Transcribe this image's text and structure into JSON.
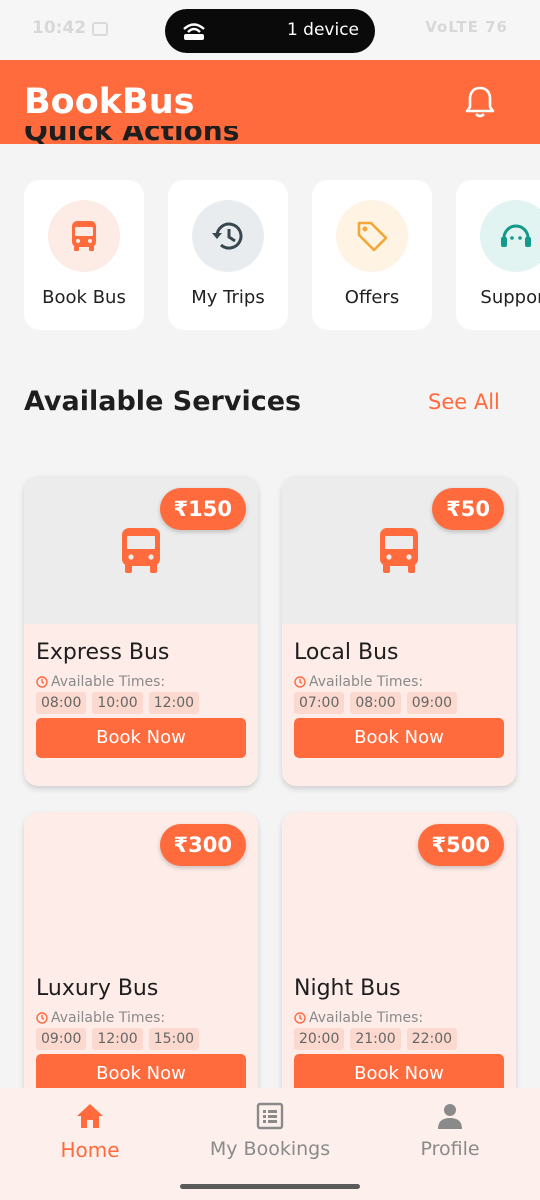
{
  "status_bar": {
    "time": "10:42",
    "hotspot_text": "1 device",
    "right_text": "VoLTE 76"
  },
  "app": {
    "title": "BookBus"
  },
  "quick_actions": {
    "heading": "Quick Actions",
    "items": [
      {
        "label": "Book Bus",
        "icon": "bus-icon",
        "bg": "#fdebe6"
      },
      {
        "label": "My Trips",
        "icon": "history-icon",
        "bg": "#e9ecef"
      },
      {
        "label": "Offers",
        "icon": "tag-icon",
        "bg": "#fff4e3"
      },
      {
        "label": "Support",
        "icon": "headset-icon",
        "bg": "#e2f4f2"
      }
    ]
  },
  "services": {
    "heading": "Available Services",
    "see_all": "See All",
    "available_label": "Available Times:",
    "book_label": "Book Now",
    "items": [
      {
        "name": "Express Bus",
        "price": "₹150",
        "times": [
          "08:00",
          "10:00",
          "12:00"
        ]
      },
      {
        "name": "Local Bus",
        "price": "₹50",
        "times": [
          "07:00",
          "08:00",
          "09:00"
        ]
      },
      {
        "name": "Luxury Bus",
        "price": "₹300",
        "times": [
          "09:00",
          "12:00",
          "15:00"
        ]
      },
      {
        "name": "Night Bus",
        "price": "₹500",
        "times": [
          "20:00",
          "21:00",
          "22:00"
        ]
      }
    ]
  },
  "bottom_nav": [
    {
      "label": "Home",
      "icon": "home-icon",
      "active": true
    },
    {
      "label": "My Bookings",
      "icon": "list-icon",
      "active": false
    },
    {
      "label": "Profile",
      "icon": "person-icon",
      "active": false
    }
  ],
  "colors": {
    "accent": "#ff6b3d",
    "card_tint": "#fdece8",
    "background": "#f4f4f4"
  }
}
